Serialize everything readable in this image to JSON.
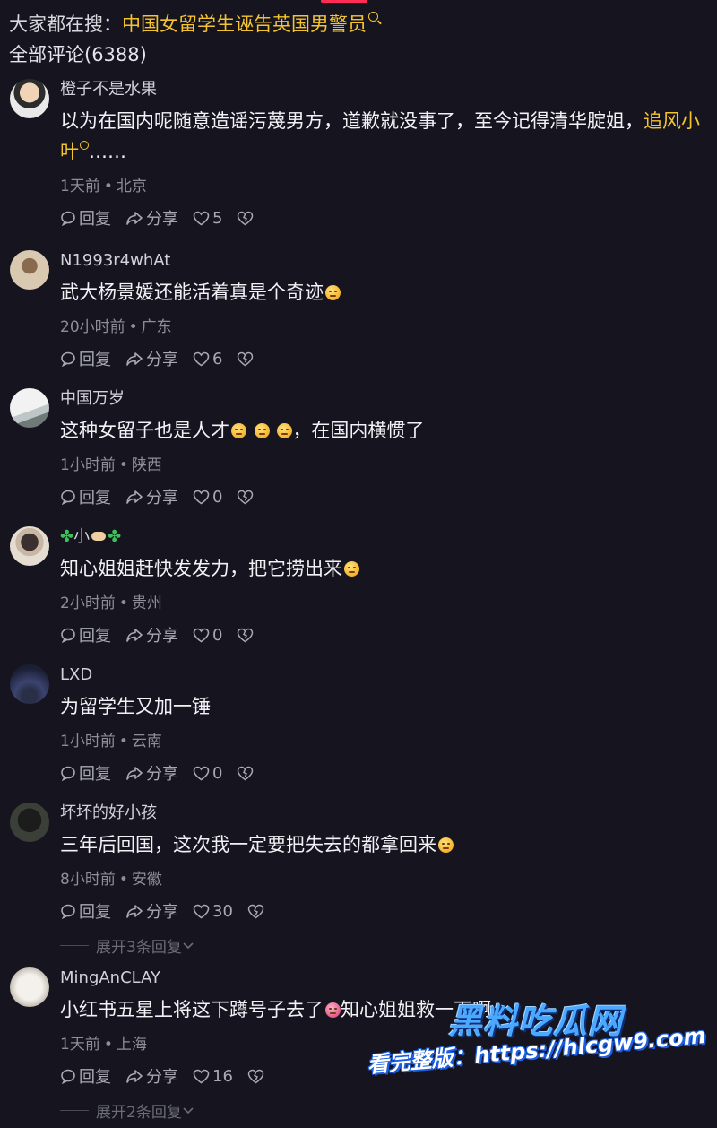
{
  "header": {
    "search_prefix": "大家都在搜：",
    "search_keyword": "中国女留学生诬告英国男警员",
    "all_comments": "全部评论(6388)"
  },
  "comments": [
    {
      "user": "橙子不是水果",
      "text_before": "以为在国内呢随意造谣污蔑男方，道歉就没事了，至今记得清华腚姐，",
      "mention": "追风小叶",
      "text_after": "……",
      "time": "1天前",
      "location": "北京",
      "reply_label": "回复",
      "share_label": "分享",
      "likes": "5"
    },
    {
      "user": "N1993r4whAt",
      "text": "武大杨景媛还能活着真是个奇迹",
      "time": "20小时前",
      "location": "广东",
      "reply_label": "回复",
      "share_label": "分享",
      "likes": "6"
    },
    {
      "user": "中国万岁",
      "text_before": "这种女留子也是人才",
      "text_after": "，在国内横惯了",
      "time": "1小时前",
      "location": "陕西",
      "reply_label": "回复",
      "share_label": "分享",
      "likes": "0"
    },
    {
      "user": "小",
      "text": "知心姐姐赶快发发力，把它捞出来",
      "time": "2小时前",
      "location": "贵州",
      "reply_label": "回复",
      "share_label": "分享",
      "likes": "0"
    },
    {
      "user": "LXD",
      "text": "为留学生又加一锤",
      "time": "1小时前",
      "location": "云南",
      "reply_label": "回复",
      "share_label": "分享",
      "likes": "0"
    },
    {
      "user": "坏坏的好小孩",
      "text": "三年后回国，这次我一定要把失去的都拿回来",
      "time": "8小时前",
      "location": "安徽",
      "reply_label": "回复",
      "share_label": "分享",
      "likes": "30",
      "expand": "展开3条回复"
    },
    {
      "user": "MingAnCLAY",
      "text_before": "小红书五星上将这下蹲号子去了",
      "text_after": "知心姐姐救一下啊",
      "time": "1天前",
      "location": "上海",
      "reply_label": "回复",
      "share_label": "分享",
      "likes": "16",
      "expand": "展开2条回复"
    }
  ],
  "watermark": {
    "brand": "黑料吃瓜网",
    "url_line": "看完整版：https://hlcgw9.com"
  },
  "colors": {
    "background": "#15141f",
    "highlight": "#f4c430",
    "meta": "#8e8e98"
  }
}
